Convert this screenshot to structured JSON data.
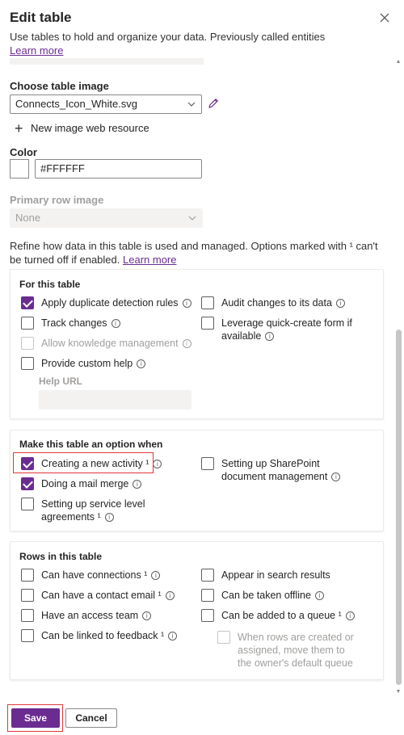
{
  "header": {
    "title": "Edit table",
    "subtitle": "Use tables to hold and organize your data. Previously called entities",
    "learn_more": "Learn more"
  },
  "table_image": {
    "label": "Choose table image",
    "value": "Connects_Icon_White.svg",
    "new_resource": "New image web resource"
  },
  "color": {
    "label": "Color",
    "value": "#FFFFFF",
    "swatch": "#FFFFFF"
  },
  "primary_row_image": {
    "label": "Primary row image",
    "value": "None"
  },
  "refine": {
    "text": "Refine how data in this table is used and managed. Options marked with ¹ can't be turned off if enabled.",
    "learn_more": "Learn more"
  },
  "for_this_table": {
    "title": "For this table",
    "options": [
      {
        "label": "Apply duplicate detection rules",
        "checked": true
      },
      {
        "label": "Track changes",
        "checked": false
      },
      {
        "label": "Allow knowledge management",
        "checked": false,
        "disabled": true
      },
      {
        "label": "Provide custom help",
        "checked": false
      },
      {
        "label": "Audit changes to its data",
        "checked": false
      },
      {
        "label": "Leverage quick-create form if available",
        "checked": false
      }
    ],
    "help_url_label": "Help URL"
  },
  "option_when": {
    "title": "Make this table an option when",
    "options": [
      {
        "label": "Creating a new activity ¹",
        "checked": true
      },
      {
        "label": "Doing a mail merge",
        "checked": true
      },
      {
        "label": "Setting up service level agreements ¹",
        "checked": false
      },
      {
        "label": "Setting up SharePoint document management",
        "checked": false
      }
    ]
  },
  "rows": {
    "title": "Rows in this table",
    "options": [
      {
        "label": "Can have connections ¹",
        "checked": false
      },
      {
        "label": "Can have a contact email ¹",
        "checked": false
      },
      {
        "label": "Have an access team",
        "checked": false
      },
      {
        "label": "Can be linked to feedback ¹",
        "checked": false
      },
      {
        "label": "Appear in search results",
        "checked": false
      },
      {
        "label": "Can be taken offline",
        "checked": false
      },
      {
        "label": "Can be added to a queue ¹",
        "checked": false
      },
      {
        "label": "When rows are created or assigned, move them to the owner's default queue",
        "checked": false,
        "disabled": true
      }
    ]
  },
  "footer": {
    "save": "Save",
    "cancel": "Cancel"
  },
  "colors": {
    "accent": "#6b2c91",
    "highlight": "#e3353b"
  },
  "icons": {
    "close": "close-icon",
    "chevron": "chevron-down-icon",
    "edit": "pencil-icon",
    "add": "plus-icon",
    "info": "info-icon"
  }
}
